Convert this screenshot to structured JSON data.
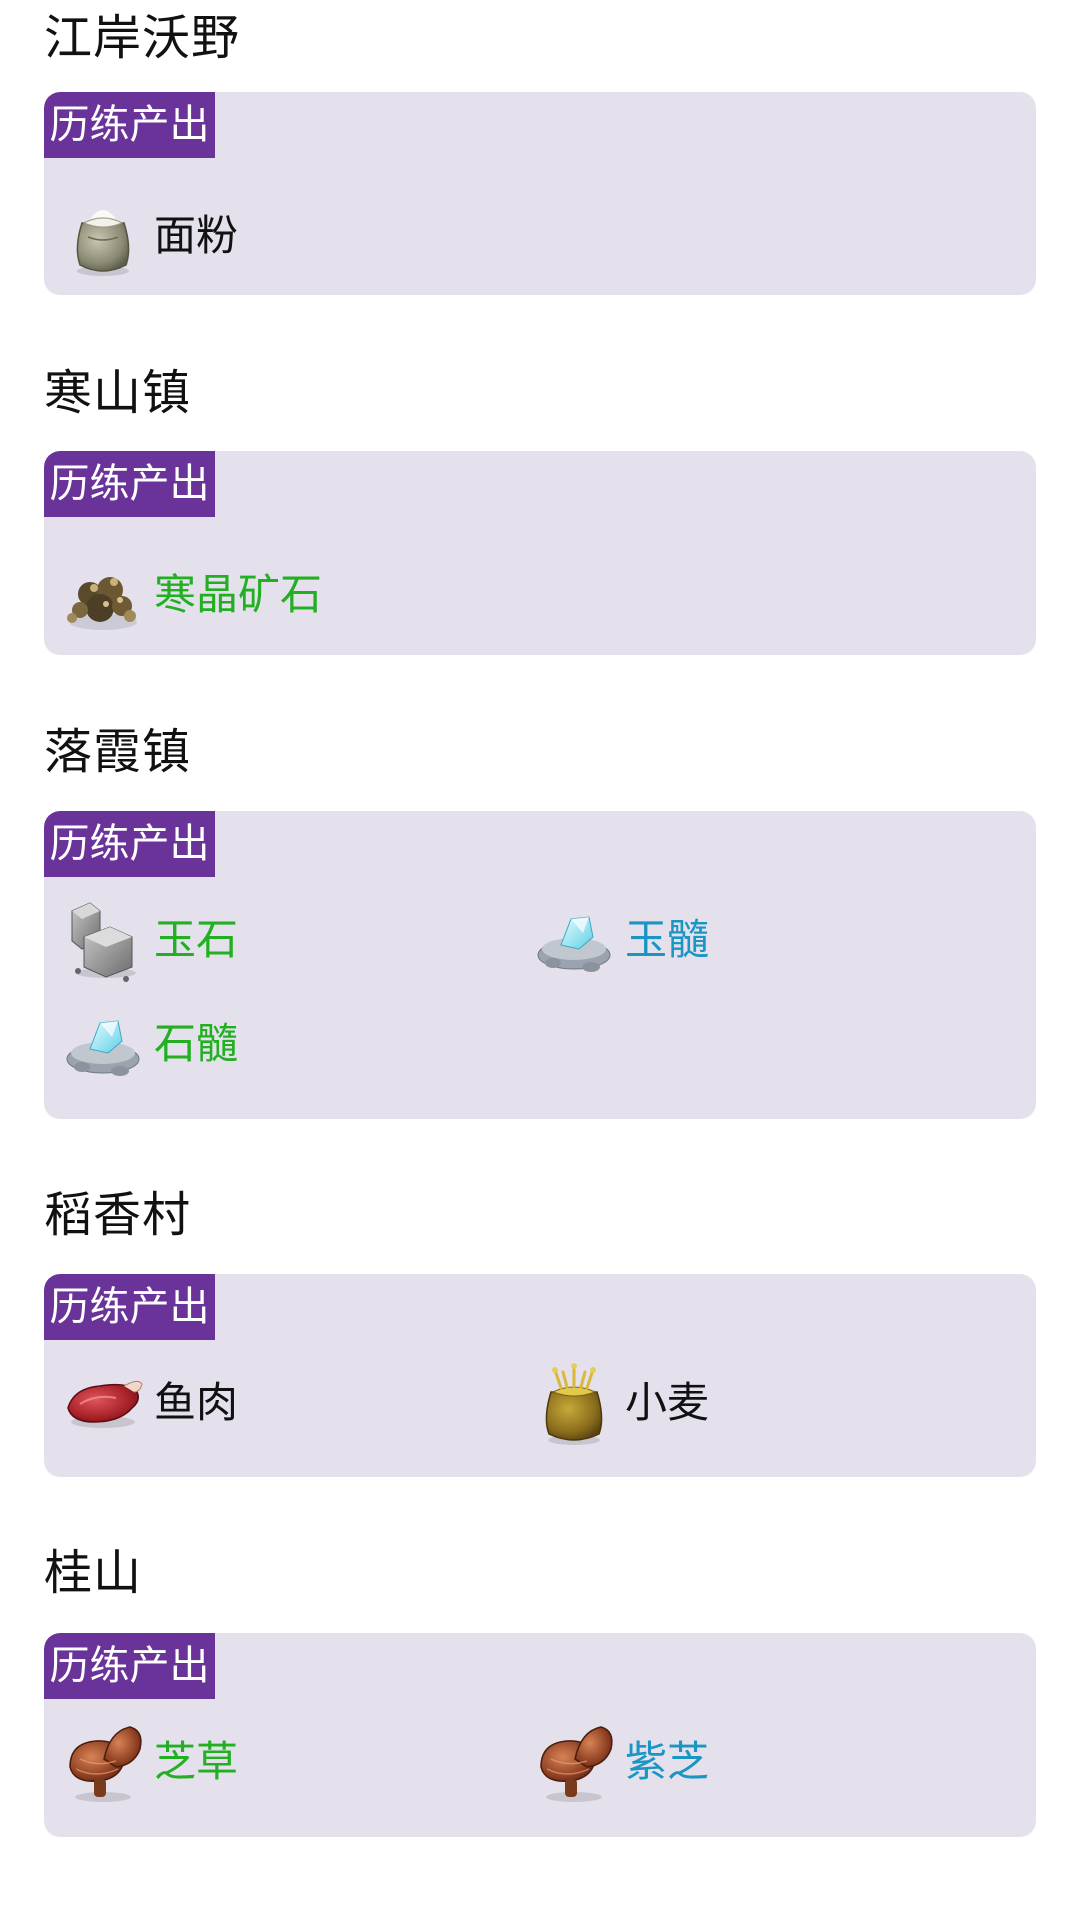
{
  "colors": {
    "card_bg": "#e4e1ec",
    "tag_bg": "#6a3399",
    "text_black": "#111111",
    "text_green": "#22b022",
    "text_blue": "#1b96c4"
  },
  "sections": [
    {
      "title": "江岸沃野",
      "tag": "历练产出",
      "items": [
        {
          "name": "面粉",
          "icon": "flour-sack-icon",
          "color": "black"
        }
      ]
    },
    {
      "title": "寒山镇",
      "tag": "历练产出",
      "items": [
        {
          "name": "寒晶矿石",
          "icon": "ore-icon",
          "color": "green"
        }
      ]
    },
    {
      "title": "落霞镇",
      "tag": "历练产出",
      "items": [
        {
          "name": "玉石",
          "icon": "stone-block-icon",
          "color": "green"
        },
        {
          "name": "玉髓",
          "icon": "crystal-icon",
          "color": "blue"
        },
        {
          "name": "石髓",
          "icon": "crystal-icon",
          "color": "green"
        }
      ]
    },
    {
      "title": "稻香村",
      "tag": "历练产出",
      "items": [
        {
          "name": "鱼肉",
          "icon": "meat-icon",
          "color": "black"
        },
        {
          "name": "小麦",
          "icon": "wheat-sack-icon",
          "color": "black"
        }
      ]
    },
    {
      "title": "桂山",
      "tag": "历练产出",
      "items": [
        {
          "name": "芝草",
          "icon": "mushroom-icon",
          "color": "green"
        },
        {
          "name": "紫芝",
          "icon": "mushroom-icon",
          "color": "blue"
        }
      ]
    }
  ]
}
